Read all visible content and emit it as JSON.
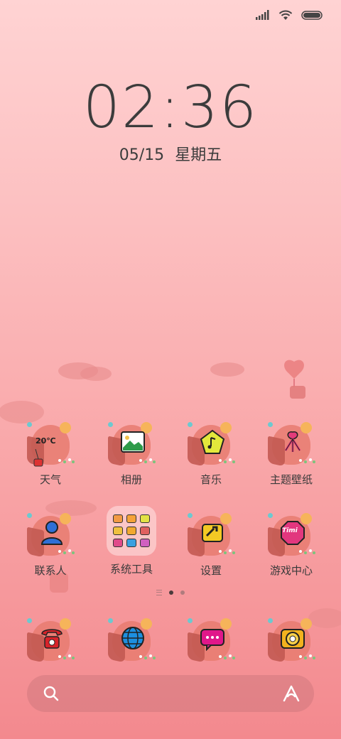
{
  "status_bar": {
    "icons": [
      "signal-icon",
      "wifi-icon",
      "battery-icon"
    ]
  },
  "clock": {
    "time": "02:36",
    "date": "05/15",
    "weekday": "星期五"
  },
  "apps": [
    {
      "name": "weather",
      "label": "天气",
      "temp": "20℃"
    },
    {
      "name": "gallery",
      "label": "相册"
    },
    {
      "name": "music",
      "label": "音乐"
    },
    {
      "name": "themes",
      "label": "主题壁纸"
    },
    {
      "name": "contacts",
      "label": "联系人"
    },
    {
      "name": "system-tools",
      "label": "系统工具"
    },
    {
      "name": "settings",
      "label": "设置"
    },
    {
      "name": "game-center",
      "label": "游戏中心",
      "badge": "Timi"
    }
  ],
  "dock": [
    {
      "name": "phone"
    },
    {
      "name": "browser"
    },
    {
      "name": "messages"
    },
    {
      "name": "camera"
    }
  ],
  "pager": {
    "pages": 2,
    "active": 1
  },
  "search": {
    "icon": "search-icon",
    "assistant_icon": "assistant-icon"
  },
  "colors": {
    "background_top": "#ffd3d3",
    "background_bottom": "#f3898e",
    "text": "#3a3a3a"
  }
}
